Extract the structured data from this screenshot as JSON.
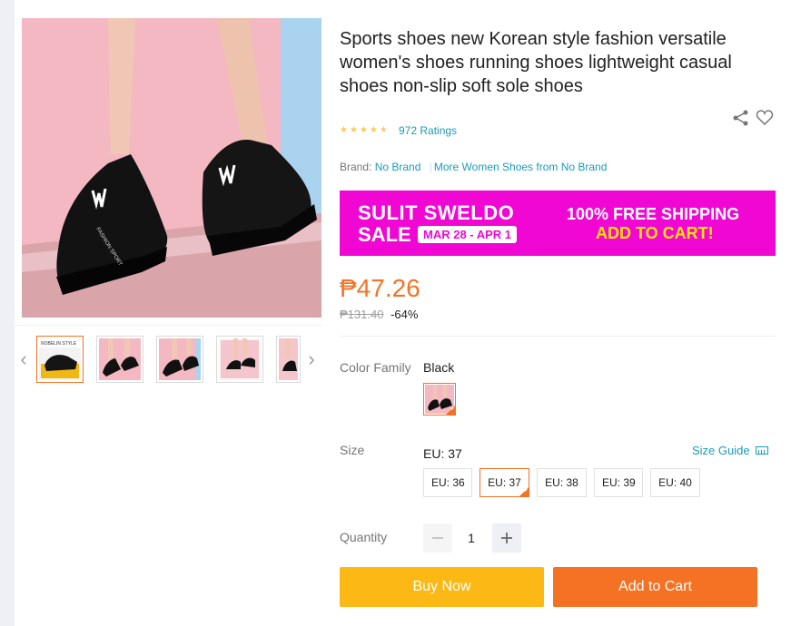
{
  "product": {
    "title": "Sports shoes new Korean style fashion versatile women's shoes running shoes lightweight casual shoes non-slip soft sole shoes",
    "rating_stars": 4.5,
    "ratings_text": "972 Ratings",
    "brand_label": "Brand:",
    "brand_name": "No Brand",
    "more_from": "More Women Shoes from No Brand"
  },
  "gallery": {
    "thumb_label_1": "NOBELIN STYLE",
    "shoe_print": "FASHION SPORT"
  },
  "banner": {
    "line1": "SULIT SWELDO",
    "line2": "SALE",
    "dates": "MAR 28 - APR 1",
    "shipping": "100% FREE SHIPPING",
    "cta": "ADD TO CART!"
  },
  "price": {
    "current": "₱47.26",
    "original": "₱131.40",
    "discount": "-64%"
  },
  "variants": {
    "color_label": "Color Family",
    "color_value": "Black",
    "size_label": "Size",
    "size_value": "EU: 37",
    "size_guide": "Size Guide",
    "sizes": [
      "EU: 36",
      "EU: 37",
      "EU: 38",
      "EU: 39",
      "EU: 40"
    ],
    "selected_size": "EU: 37"
  },
  "quantity": {
    "label": "Quantity",
    "value": "1"
  },
  "actions": {
    "buy_now": "Buy Now",
    "add_to_cart": "Add to Cart"
  },
  "colors": {
    "accent": "#f57224",
    "buy_now_bg": "#fcb814",
    "link": "#1a9cb7",
    "banner_bg": "#f007d4",
    "star": "#faca51"
  },
  "icons": [
    "chevron-left-icon",
    "chevron-right-icon",
    "share-icon",
    "heart-icon",
    "ruler-icon",
    "minus-icon",
    "plus-icon",
    "star-icon"
  ]
}
